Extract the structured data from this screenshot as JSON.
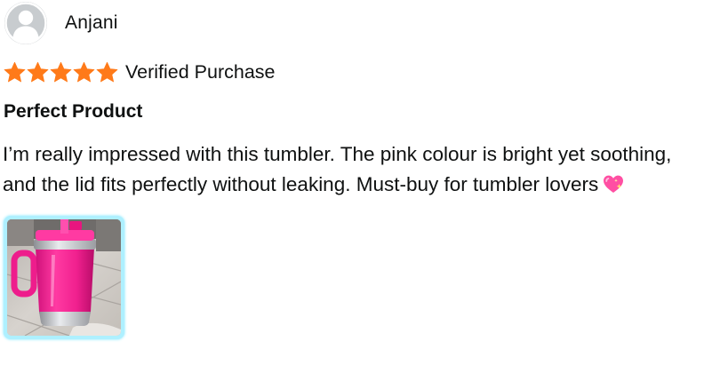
{
  "reviewer": {
    "name": "Anjani",
    "avatar_icon": "user-avatar-icon"
  },
  "rating": {
    "stars": 5,
    "max": 5,
    "star_color": "#ff7a19",
    "badge": "Verified Purchase"
  },
  "review": {
    "title": "Perfect Product",
    "body_lines": [
      "I’m really impressed with this tumbler. The pink colour is bright yet soothing,",
      "and the lid fits perfectly without leaking. Must-buy for tumbler lovers"
    ],
    "emoji_icon": "sparkling-heart-icon"
  },
  "photos": [
    {
      "subject": "pink tumbler with handle and straw",
      "accent": "#ff2f96"
    }
  ],
  "colors": {
    "text": "#0f1111",
    "thumb_border": "#aef0ff"
  }
}
